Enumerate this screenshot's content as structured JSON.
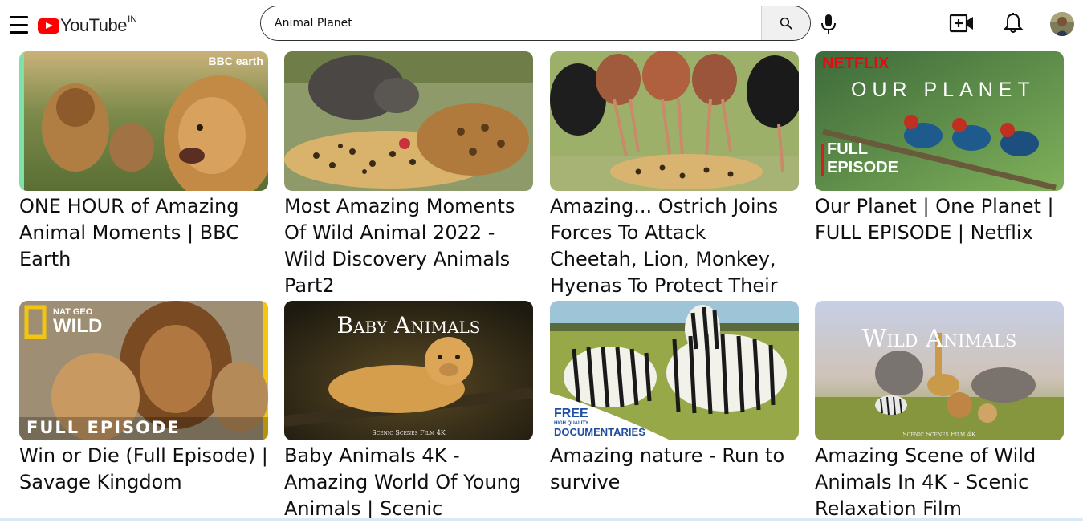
{
  "header": {
    "logo_word": "YouTube",
    "country_code": "IN",
    "search_value": "Animal Planet",
    "menu_icon": "hamburger-menu-icon",
    "search_icon": "search-icon",
    "mic_icon": "microphone-icon",
    "create_icon": "video-create-icon",
    "bell_icon": "bell-icon"
  },
  "colors": {
    "brand_red": "#ff0000",
    "text": "#0f0f0f",
    "search_button_bg": "#f0f0f0"
  },
  "videos": [
    {
      "title": "ONE HOUR of Amazing Animal Moments | BBC Earth",
      "overlay": "BBC earth"
    },
    {
      "title": "Most Amazing Moments Of Wild Animal 2022 - Wild Discovery Animals Part2",
      "overlay": ""
    },
    {
      "title": "Amazing... Ostrich Joins Forces To Attack Cheetah, Lion, Monkey, Hyenas To Protect Their",
      "overlay": ""
    },
    {
      "title": "Our Planet | One Planet | FULL EPISODE | Netflix",
      "overlay_brand": "NETFLIX",
      "overlay_title": "OUR PLANET",
      "overlay_line1": "FULL",
      "overlay_line2": "EPISODE"
    },
    {
      "title": "Win or Die (Full Episode) | Savage Kingdom",
      "overlay_brand1": "NAT GEO",
      "overlay_brand2": "WILD",
      "overlay_bottom": "FULL EPISODE"
    },
    {
      "title": "Baby Animals 4K - Amazing World Of Young Animals | Scenic",
      "overlay_title": "Baby Animals",
      "overlay_credit": "Scenic Scenes Film 4K"
    },
    {
      "title": "Amazing nature - Run to survive",
      "overlay_line1": "FREE",
      "overlay_line2": "HIGH QUALITY",
      "overlay_line3": "DOCUMENTARIES"
    },
    {
      "title": "Amazing Scene of Wild Animals In 4K - Scenic Relaxation Film",
      "overlay_title": "Wild Animals",
      "overlay_credit": "Scenic Scenes Film 4K"
    }
  ]
}
